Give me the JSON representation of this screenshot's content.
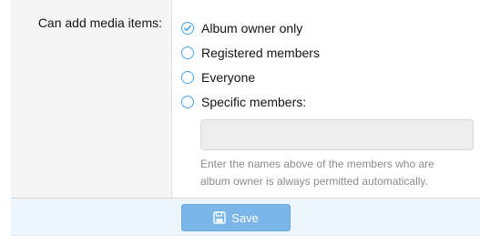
{
  "form": {
    "label": "Can add media items:",
    "options": [
      {
        "label": "Album owner only",
        "checked": true
      },
      {
        "label": "Registered members",
        "checked": false
      },
      {
        "label": "Everyone",
        "checked": false
      },
      {
        "label": "Specific members:",
        "checked": false
      }
    ],
    "members_input_value": "",
    "explain_line1": "Enter the names above of the members who are",
    "explain_line2": "album owner is always permitted automatically."
  },
  "submit": {
    "save_label": "Save",
    "save_icon": "floppy-disk-icon"
  },
  "colors": {
    "accent": "#47a7eb",
    "button": "#7ab6e8",
    "submit_bar": "#edf6fd"
  }
}
